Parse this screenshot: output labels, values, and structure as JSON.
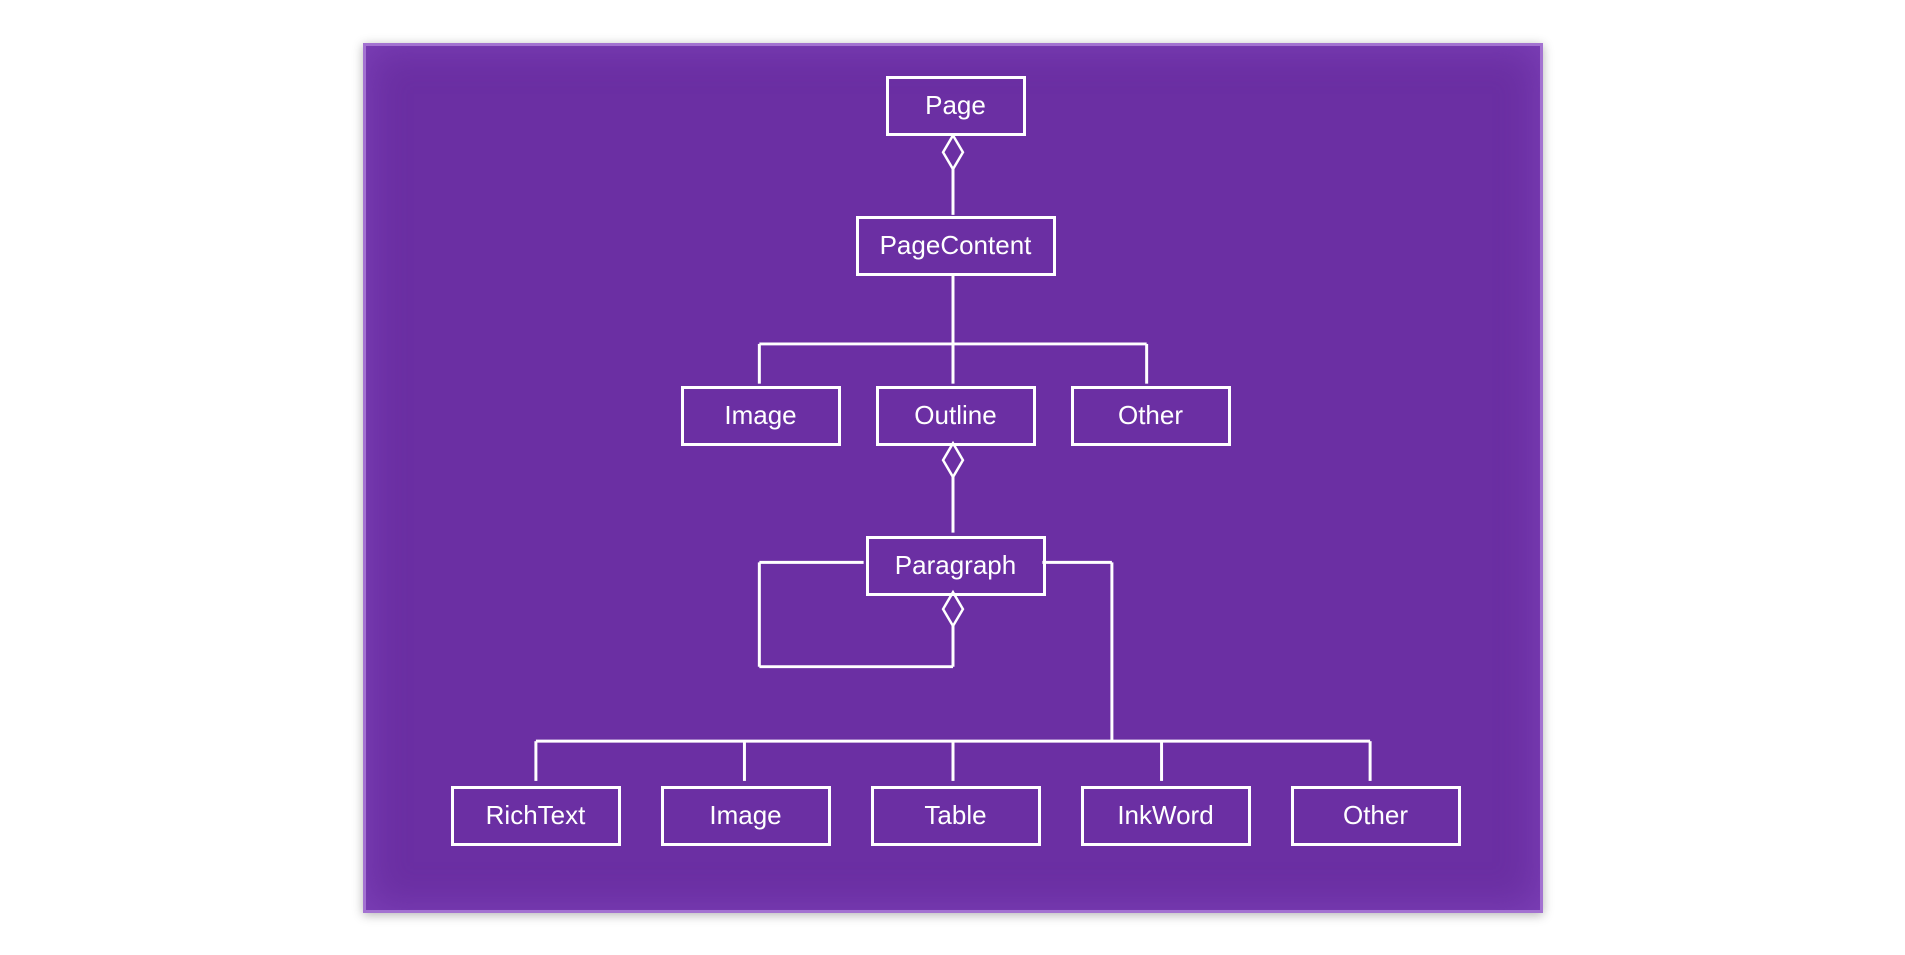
{
  "diagram": {
    "nodes": {
      "page": "Page",
      "pageContent": "PageContent",
      "image1": "Image",
      "outline": "Outline",
      "other1": "Other",
      "paragraph": "Paragraph",
      "richText": "RichText",
      "image2": "Image",
      "table": "Table",
      "inkWord": "InkWord",
      "other2": "Other"
    },
    "colors": {
      "background": "#6B2FA3",
      "border": "#ffffff",
      "text": "#ffffff"
    },
    "relationships": [
      {
        "from": "page",
        "to": "pageContent",
        "type": "aggregation"
      },
      {
        "from": "pageContent",
        "to": "image1",
        "type": "composition-branch"
      },
      {
        "from": "pageContent",
        "to": "outline",
        "type": "composition-branch"
      },
      {
        "from": "pageContent",
        "to": "other1",
        "type": "composition-branch"
      },
      {
        "from": "outline",
        "to": "paragraph",
        "type": "aggregation"
      },
      {
        "from": "paragraph",
        "to": "paragraph",
        "type": "self-aggregation"
      },
      {
        "from": "paragraph",
        "to": "richText",
        "type": "composition-branch"
      },
      {
        "from": "paragraph",
        "to": "image2",
        "type": "composition-branch"
      },
      {
        "from": "paragraph",
        "to": "table",
        "type": "composition-branch"
      },
      {
        "from": "paragraph",
        "to": "inkWord",
        "type": "composition-branch"
      },
      {
        "from": "paragraph",
        "to": "other2",
        "type": "composition-branch"
      }
    ]
  }
}
